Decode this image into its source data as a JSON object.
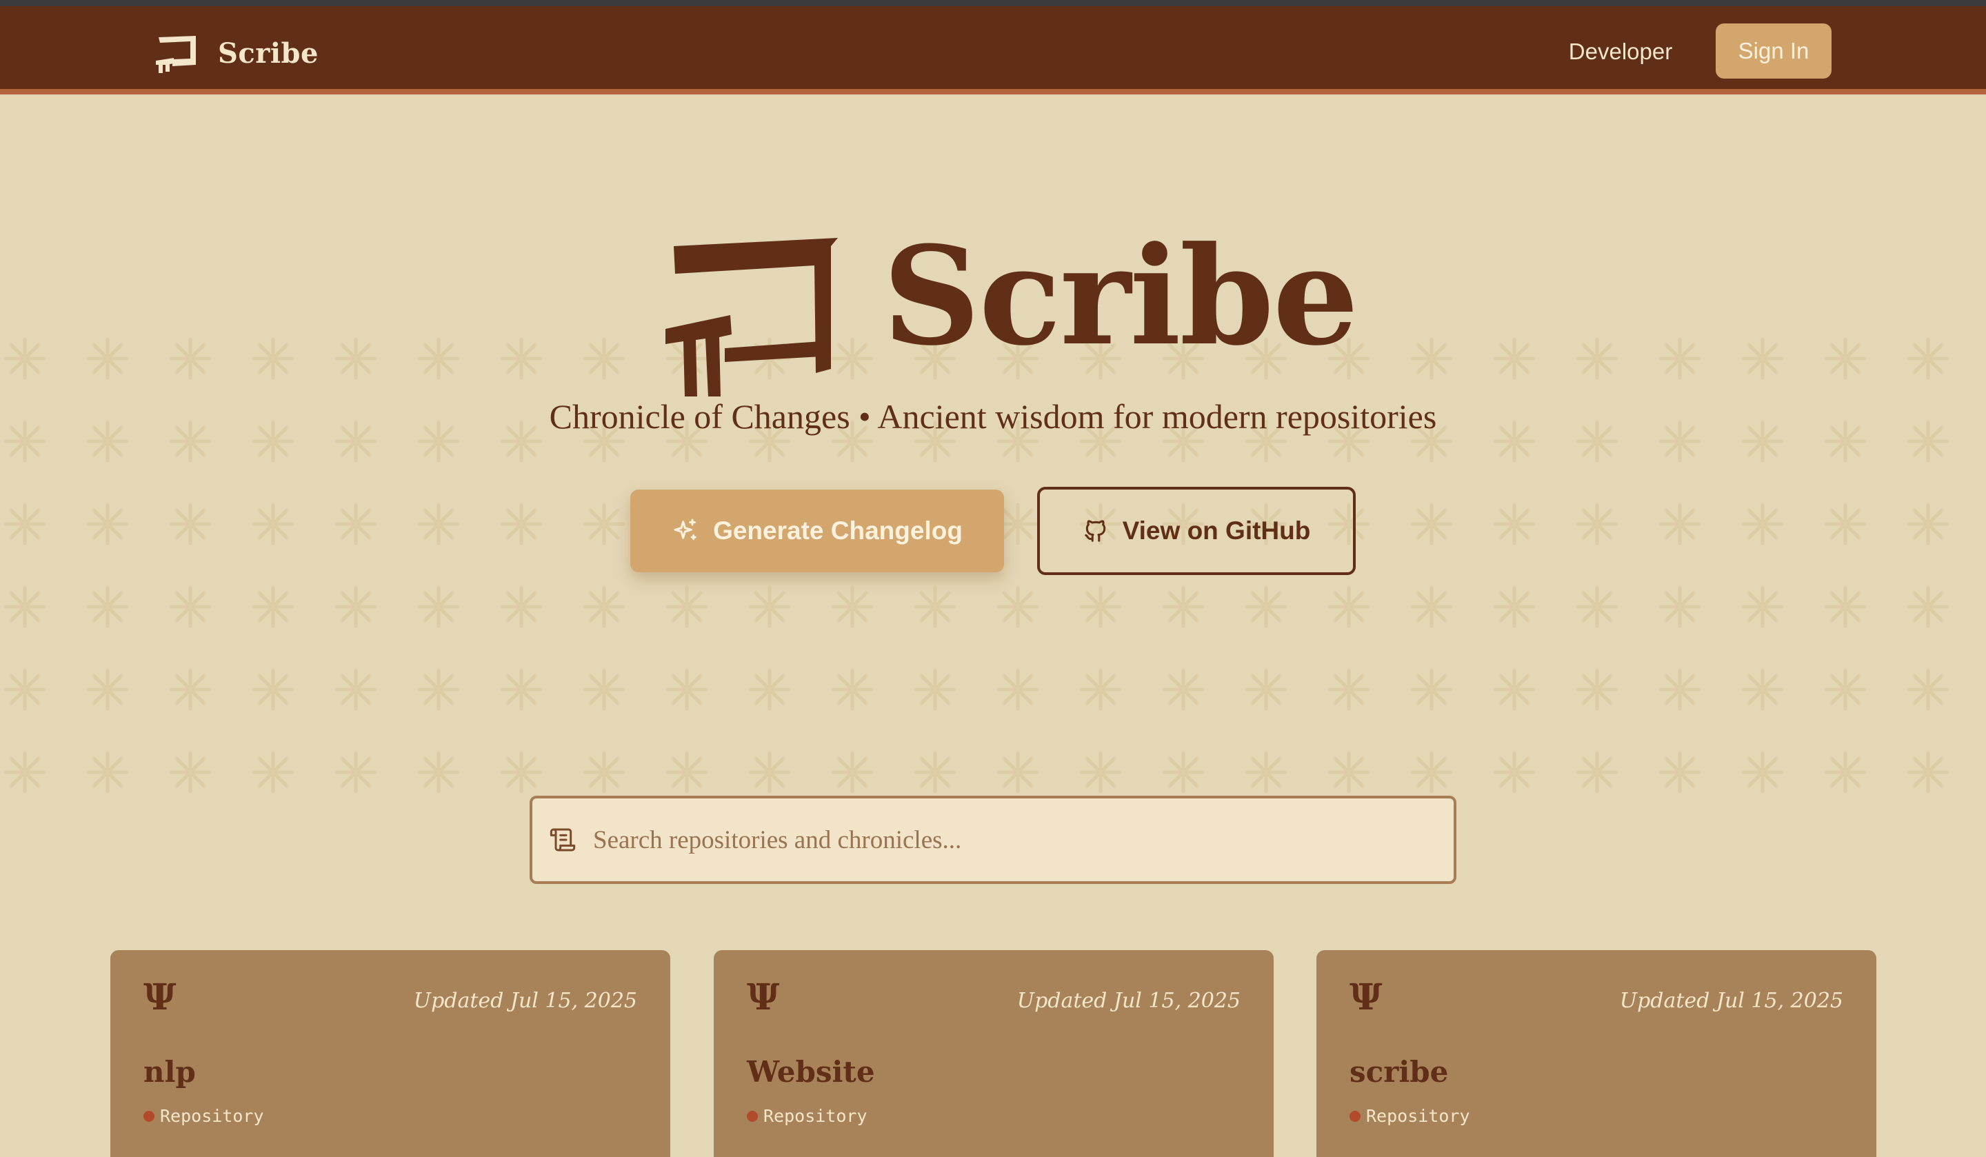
{
  "navbar": {
    "brand_name": "Scribe",
    "developer_label": "Developer",
    "signin_label": "Sign In"
  },
  "hero": {
    "title": "Scribe",
    "subtitle": "Chronicle of Changes • Ancient wisdom for modern repositories",
    "primary_button": "Generate Changelog",
    "secondary_button": "View on GitHub"
  },
  "search": {
    "placeholder": "Search repositories and chronicles..."
  },
  "repos": [
    {
      "glyph": "Ψ",
      "updated": "Updated Jul 15, 2025",
      "name": "nlp",
      "type": "Repository"
    },
    {
      "glyph": "Ψ",
      "updated": "Updated Jul 15, 2025",
      "name": "Website",
      "type": "Repository"
    },
    {
      "glyph": "Ψ",
      "updated": "Updated Jul 15, 2025",
      "name": "scribe",
      "type": "Repository"
    }
  ],
  "colors": {
    "background": "#e4d7b5",
    "navbar": "#612f17",
    "accent": "#d3a66e",
    "card": "#a8835a",
    "text_dark": "#612f17",
    "text_light": "#f4e6c9",
    "status_dot": "#b24a2c"
  },
  "icons": {
    "brand_logo": "cuneiform-scribe-icon",
    "primary_button": "sparkles-icon",
    "secondary_button": "github-icon",
    "search": "scroll-icon",
    "card_glyph": "psi-glyph-icon"
  }
}
